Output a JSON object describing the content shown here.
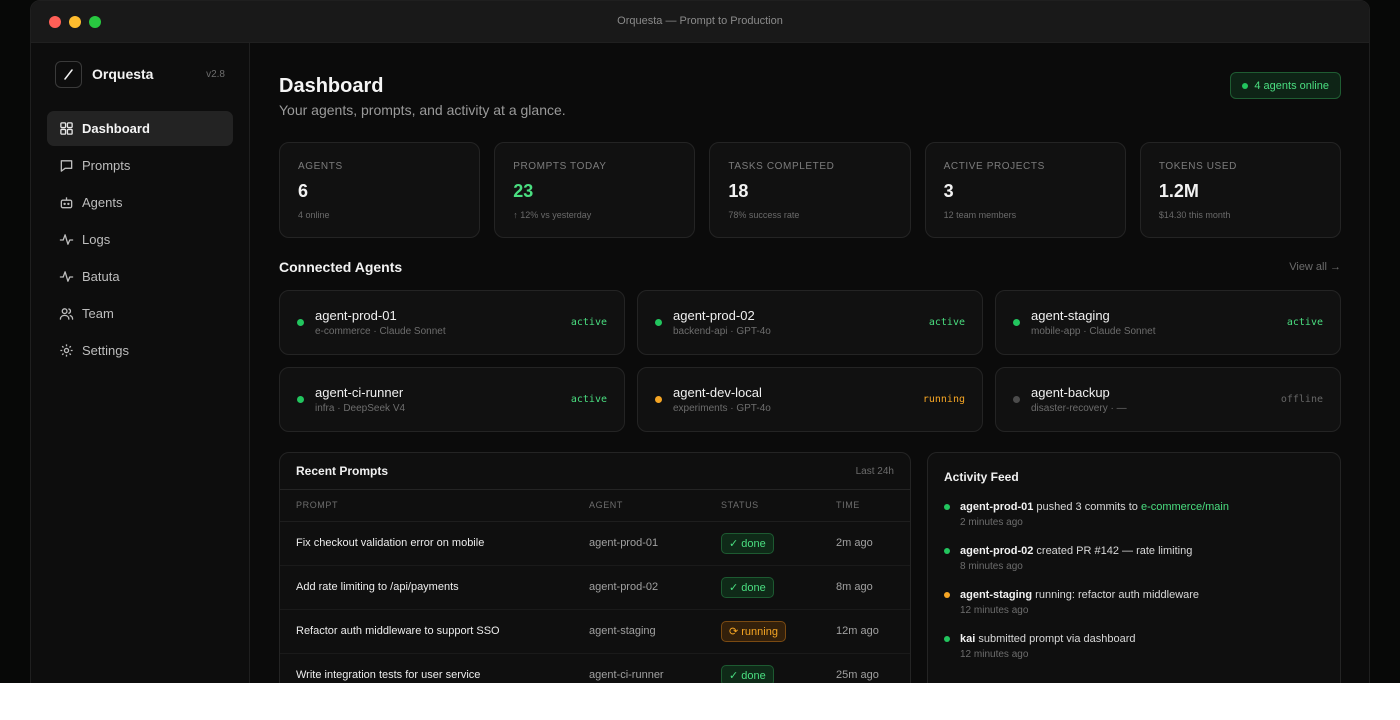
{
  "window": {
    "title": "Orquesta — Prompt to Production"
  },
  "brand": {
    "name": "Orquesta",
    "version": "v2.8"
  },
  "sidebar": {
    "items": [
      {
        "label": "Dashboard",
        "icon": "grid-icon",
        "active": true
      },
      {
        "label": "Prompts",
        "icon": "message-icon",
        "active": false
      },
      {
        "label": "Agents",
        "icon": "bot-icon",
        "active": false
      },
      {
        "label": "Logs",
        "icon": "activity-icon",
        "active": false
      },
      {
        "label": "Batuta",
        "icon": "activity-icon",
        "active": false
      },
      {
        "label": "Team",
        "icon": "users-icon",
        "active": false
      },
      {
        "label": "Settings",
        "icon": "gear-icon",
        "active": false
      }
    ]
  },
  "header": {
    "title": "Dashboard",
    "subtitle": "Your agents, prompts, and activity at a glance.",
    "online_badge": "4 agents online"
  },
  "stats": [
    {
      "label": "AGENTS",
      "value": "6",
      "sub": "4 online"
    },
    {
      "label": "PROMPTS TODAY",
      "value": "23",
      "sub": "↑ 12% vs yesterday",
      "accent": "#4ade80"
    },
    {
      "label": "TASKS COMPLETED",
      "value": "18",
      "sub": "78% success rate"
    },
    {
      "label": "ACTIVE PROJECTS",
      "value": "3",
      "sub": "12 team members"
    },
    {
      "label": "TOKENS USED",
      "value": "1.2M",
      "sub": "$14.30 this month"
    }
  ],
  "connected_agents": {
    "title": "Connected Agents",
    "view_all": "View all →",
    "items": [
      {
        "name": "agent-prod-01",
        "meta": "e-commerce · Claude Sonnet",
        "status": "active"
      },
      {
        "name": "agent-prod-02",
        "meta": "backend-api · GPT-4o",
        "status": "active"
      },
      {
        "name": "agent-staging",
        "meta": "mobile-app · Claude Sonnet",
        "status": "active"
      },
      {
        "name": "agent-ci-runner",
        "meta": "infra · DeepSeek V4",
        "status": "active"
      },
      {
        "name": "agent-dev-local",
        "meta": "experiments · GPT-4o",
        "status": "running"
      },
      {
        "name": "agent-backup",
        "meta": "disaster-recovery · —",
        "status": "offline"
      }
    ]
  },
  "recent_prompts": {
    "title": "Recent Prompts",
    "range": "Last 24h",
    "columns": [
      "PROMPT",
      "AGENT",
      "STATUS",
      "TIME"
    ],
    "rows": [
      {
        "prompt": "Fix checkout validation error on mobile",
        "agent": "agent-prod-01",
        "status": "✓ done",
        "kind": "done",
        "time": "2m ago"
      },
      {
        "prompt": "Add rate limiting to /api/payments",
        "agent": "agent-prod-02",
        "status": "✓ done",
        "kind": "done",
        "time": "8m ago"
      },
      {
        "prompt": "Refactor auth middleware to support SSO",
        "agent": "agent-staging",
        "status": "⟳ running",
        "kind": "running",
        "time": "12m ago"
      },
      {
        "prompt": "Write integration tests for user service",
        "agent": "agent-ci-runner",
        "status": "✓ done",
        "kind": "done",
        "time": "25m ago"
      }
    ]
  },
  "activity_feed": {
    "title": "Activity Feed",
    "items": [
      {
        "actor": "agent-prod-01",
        "text": " pushed 3 commits to ",
        "link": "e-commerce/main",
        "time": "2 minutes ago",
        "color": "#22c55e"
      },
      {
        "actor": "agent-prod-02",
        "text": " created PR #142 — rate limiting",
        "link": "",
        "time": "8 minutes ago",
        "color": "#22c55e"
      },
      {
        "actor": "agent-staging",
        "text": " running: refactor auth middleware",
        "link": "",
        "time": "12 minutes ago",
        "color": "#f5a524"
      },
      {
        "actor": "kai",
        "text": " submitted prompt via dashboard",
        "link": "",
        "time": "12 minutes ago",
        "color": "#22c55e"
      }
    ]
  }
}
